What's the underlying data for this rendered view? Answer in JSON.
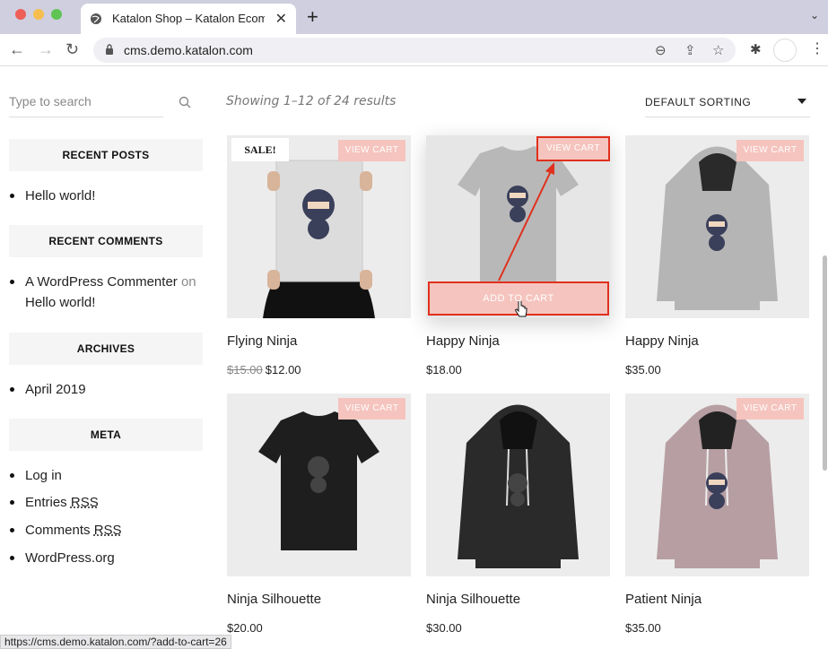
{
  "browser": {
    "tab_title": "Katalon Shop – Katalon Ecomm",
    "url": "cms.demo.katalon.com",
    "status_url": "https://cms.demo.katalon.com/?add-to-cart=26"
  },
  "sidebar": {
    "search_placeholder": "Type to search",
    "recent_posts": {
      "title": "RECENT POSTS",
      "items": [
        "Hello world!"
      ]
    },
    "recent_comments": {
      "title": "RECENT COMMENTS",
      "author": "A WordPress Commenter",
      "on": "on",
      "post": "Hello world!"
    },
    "archives": {
      "title": "ARCHIVES",
      "items": [
        "April 2019"
      ]
    },
    "meta": {
      "title": "META",
      "login": "Log in",
      "entries_prefix": "Entries",
      "comments_prefix": "Comments",
      "rss": "RSS",
      "wp": "WordPress.org"
    }
  },
  "shop": {
    "results_text": "Showing 1–12 of 24 results",
    "sorting": "DEFAULT SORTING",
    "view_cart": "VIEW CART",
    "add_to_cart": "ADD TO CART",
    "sale_badge": "SALE!",
    "products": [
      {
        "name": "Flying Ninja",
        "old_price": "$15.00",
        "price": "$12.00"
      },
      {
        "name": "Happy Ninja",
        "price": "$18.00"
      },
      {
        "name": "Happy Ninja",
        "price": "$35.00"
      },
      {
        "name": "Ninja Silhouette",
        "price": "$20.00"
      },
      {
        "name": "Ninja Silhouette",
        "price": "$30.00"
      },
      {
        "name": "Patient Ninja",
        "price": "$35.00"
      }
    ]
  },
  "colors": {
    "accent": "#f5c4be",
    "highlight": "#e0301e"
  }
}
